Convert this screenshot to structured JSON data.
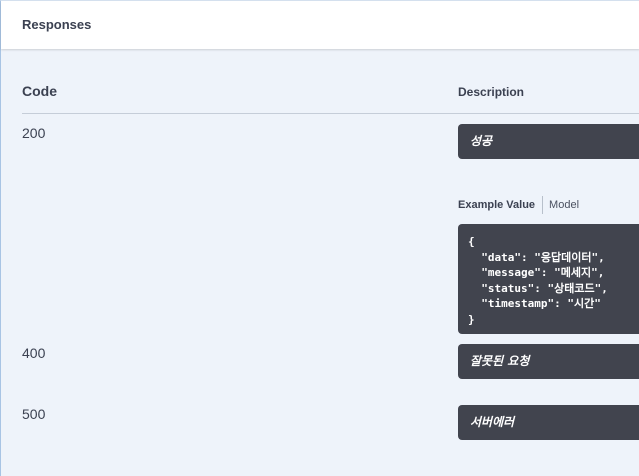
{
  "responses": {
    "title": "Responses",
    "columns": {
      "code": "Code",
      "description": "Description"
    },
    "rows": [
      {
        "code": "200",
        "description": "성공"
      },
      {
        "code": "400",
        "description": "잘못된 요청"
      },
      {
        "code": "500",
        "description": "서버에러"
      }
    ],
    "tabs": {
      "example": "Example Value",
      "model": "Model"
    },
    "example_json": {
      "open": "{",
      "lines": [
        "  \"data\": \"응답데이터\",",
        "  \"message\": \"메세지\",",
        "  \"status\": \"상태코드\",",
        "  \"timestamp\": \"시간\""
      ],
      "close": "}"
    }
  },
  "colors": {
    "panel_bg": "#eef3fa",
    "code_bg": "#41444e",
    "text": "#3b4151"
  }
}
